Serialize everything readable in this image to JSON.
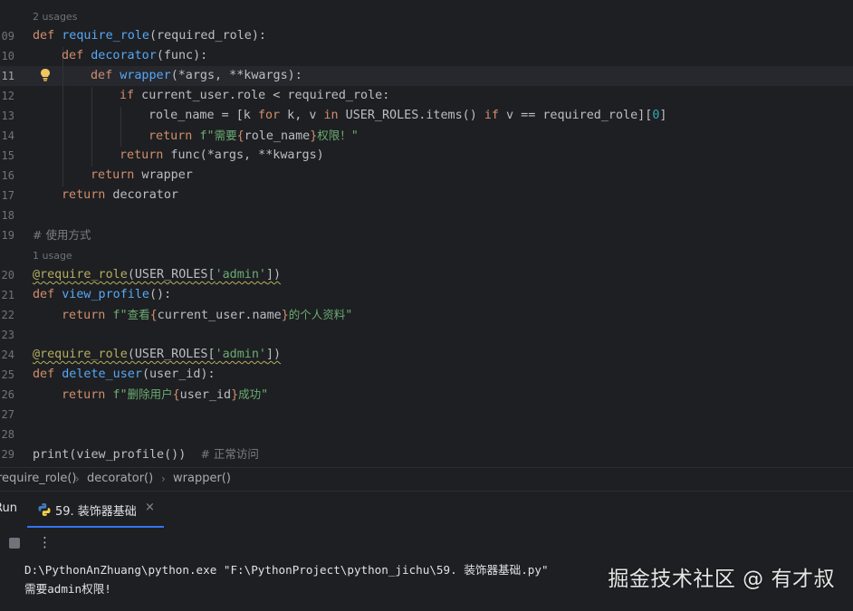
{
  "editor": {
    "usage_hint_top": "2 usages",
    "usage_hint_mid": "1 usage",
    "line_numbers": [
      "09",
      "10",
      "11",
      "12",
      "13",
      "14",
      "15",
      "16",
      "17",
      "18",
      "19",
      "20",
      "21",
      "22",
      "23",
      "24",
      "25",
      "26",
      "27",
      "28",
      "29"
    ],
    "current_line": "11",
    "lines": {
      "l09": {
        "kw": "def",
        "name": "require_role",
        "rest": "(required_role):"
      },
      "l10": {
        "kw": "def",
        "name": "decorator",
        "rest": "(func):"
      },
      "l11": {
        "kw": "def",
        "name": "wrapper",
        "rest": "(*args, **kwargs):"
      },
      "l12": {
        "kw": "if",
        "rest": " current_user.role < required_role:"
      },
      "l13": {
        "a": "role_name = [k ",
        "for": "for",
        "b": " k, v ",
        "in": "in",
        "c": " USER_ROLES.items() ",
        "if": "if",
        "d": " v == required_role][",
        "zero": "0",
        "e": "]"
      },
      "l14": {
        "kw": "return",
        "pre": "f\"",
        "t1": "需要",
        "o": "{",
        "var": "role_name",
        "c": "}",
        "t2": "权限！",
        "post": "\""
      },
      "l15": {
        "kw": "return",
        "rest": " func(*args, **kwargs)"
      },
      "l16": {
        "kw": "return",
        "rest": " wrapper"
      },
      "l17": {
        "kw": "return",
        "rest": " decorator"
      },
      "l19": {
        "comment": "# 使用方式"
      },
      "l20": {
        "dec": "@require_role",
        "open": "(USER_ROLES[",
        "arg": "'admin'",
        "close": "])"
      },
      "l21": {
        "kw": "def",
        "name": "view_profile",
        "rest": "():"
      },
      "l22": {
        "kw": "return",
        "pre": "f\"",
        "t1": "查看",
        "o": "{",
        "var": "current_user.name",
        "c": "}",
        "t2": "的个人资料",
        "post": "\""
      },
      "l24": {
        "dec": "@require_role",
        "open": "(USER_ROLES[",
        "arg": "'admin'",
        "close": "])"
      },
      "l25": {
        "kw": "def",
        "name": "delete_user",
        "rest": "(user_id):"
      },
      "l26": {
        "kw": "return",
        "pre": "f\"",
        "t1": "删除用户",
        "o": "{",
        "var": "user_id",
        "c": "}",
        "t2": "成功",
        "post": "\""
      },
      "l29": {
        "call": "print(view_profile())",
        "comment": "# 正常访问"
      }
    }
  },
  "breadcrumb": {
    "items": [
      "require_role()",
      "decorator()",
      "wrapper()"
    ],
    "separator": "›"
  },
  "run_panel": {
    "title": "Run",
    "tab_label": "59. 装饰器基础",
    "close_glyph": "×",
    "more_glyph": "⋮",
    "console": {
      "line1": "D:\\PythonAnZhuang\\python.exe \"F:\\PythonProject\\python_jichu\\59. 装饰器基础.py\"",
      "line2": "需要admin权限!"
    }
  },
  "watermark": "掘金技术社区 @ 有才叔",
  "colors": {
    "background": "#1e1f22",
    "keyword": "#cf8e6d",
    "function": "#56a8f5",
    "string": "#6aab73",
    "comment": "#7a7e85",
    "decorator": "#b3ae60",
    "number": "#2aacb8",
    "tab_accent": "#3574f0"
  },
  "icons": {
    "intention": "lightbulb-icon",
    "tab": "python-file-icon",
    "stop": "stop-icon",
    "more": "more-vertical-icon"
  }
}
